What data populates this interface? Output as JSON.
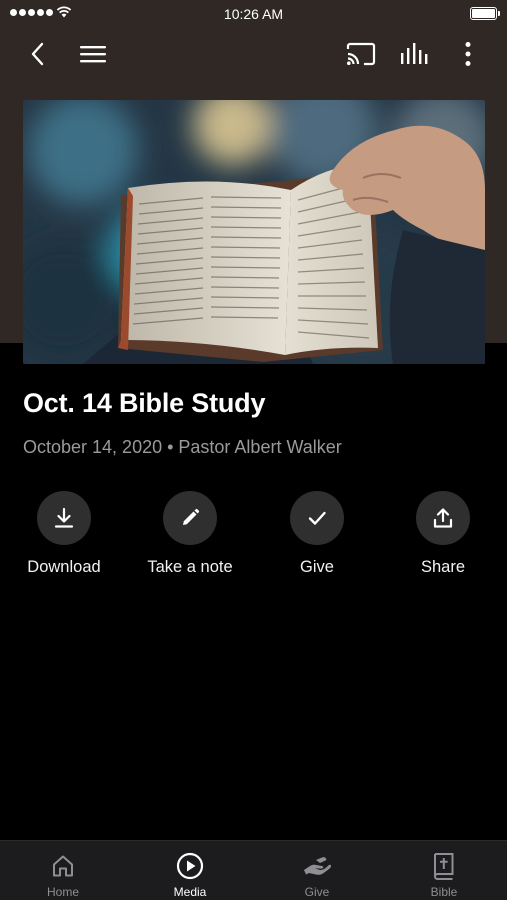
{
  "status_bar": {
    "time": "10:26 AM"
  },
  "nav": {
    "back_icon": "chevron-left-icon",
    "menu_icon": "hamburger-menu-icon",
    "cast_icon": "cast-icon",
    "audio_icon": "audio-levels-icon",
    "more_icon": "more-vertical-icon"
  },
  "hero": {
    "image": "open-bible-held-in-hands-photo"
  },
  "media": {
    "title": "Oct. 14 Bible Study",
    "meta": "October 14, 2020 • Pastor Albert Walker"
  },
  "actions": [
    {
      "label": "Download",
      "icon": "download-icon"
    },
    {
      "label": "Take a note",
      "icon": "pencil-icon"
    },
    {
      "label": "Give",
      "icon": "checkmark-icon"
    },
    {
      "label": "Share",
      "icon": "share-icon"
    }
  ],
  "tabs": [
    {
      "label": "Home",
      "icon": "home-icon",
      "active": false
    },
    {
      "label": "Media",
      "icon": "play-circle-icon",
      "active": true
    },
    {
      "label": "Give",
      "icon": "give-hand-icon",
      "active": false
    },
    {
      "label": "Bible",
      "icon": "bible-icon",
      "active": false
    }
  ],
  "colors": {
    "header_bg": "#2f2824",
    "background": "#000000",
    "action_circle": "#2f2f2f",
    "meta_text": "#9a9a9a",
    "tab_bar_bg": "#1c1c1e",
    "tab_inactive": "#8e8e93"
  }
}
